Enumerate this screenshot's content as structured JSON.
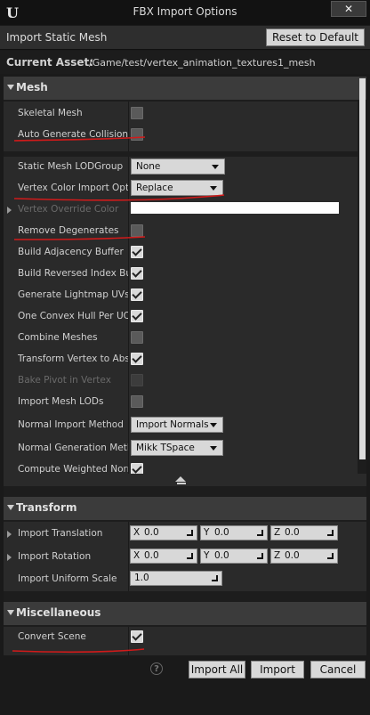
{
  "window": {
    "title": "FBX Import Options",
    "close_glyph": "✕",
    "logo_glyph": "U"
  },
  "header": {
    "title": "Import Static Mesh",
    "reset_label": "Reset to Default"
  },
  "asset": {
    "label": "Current Asset:",
    "path": "/Game/test/vertex_animation_textures1_mesh"
  },
  "sections": {
    "mesh": {
      "title": "Mesh"
    },
    "transform": {
      "title": "Transform"
    },
    "misc": {
      "title": "Miscellaneous"
    }
  },
  "mesh": {
    "skeletal_mesh": {
      "label": "Skeletal Mesh",
      "checked": false
    },
    "auto_generate_collision": {
      "label": "Auto Generate Collision",
      "checked": false
    },
    "lod_group": {
      "label": "Static Mesh LODGroup",
      "value": "None"
    },
    "vertex_color_import": {
      "label": "Vertex Color Import Option",
      "value": "Replace"
    },
    "vertex_override_color": {
      "label": "Vertex Override Color",
      "color": "#ffffff"
    },
    "remove_degenerates": {
      "label": "Remove Degenerates",
      "checked": false
    },
    "build_adjacency_buffer": {
      "label": "Build Adjacency Buffer",
      "checked": true
    },
    "build_reversed_index_buffer": {
      "label": "Build Reversed Index Buffer",
      "checked": true
    },
    "generate_lightmap_uvs": {
      "label": "Generate Lightmap UVs",
      "checked": true
    },
    "one_convex_hull": {
      "label": "One Convex Hull Per UCX",
      "checked": true
    },
    "combine_meshes": {
      "label": "Combine Meshes",
      "checked": false
    },
    "transform_vertex": {
      "label": "Transform Vertex to Absolute",
      "checked": true
    },
    "bake_pivot": {
      "label": "Bake Pivot in Vertex",
      "checked": false
    },
    "import_mesh_lods": {
      "label": "Import Mesh LODs",
      "checked": false
    },
    "normal_import_method": {
      "label": "Normal Import Method",
      "value": "Import Normals"
    },
    "normal_generation_method": {
      "label": "Normal Generation Method",
      "value": "Mikk TSpace"
    },
    "compute_weighted_normals": {
      "label": "Compute Weighted Normals",
      "checked": true
    }
  },
  "transform": {
    "import_translation": {
      "label": "Import Translation",
      "x": "0.0",
      "y": "0.0",
      "z": "0.0"
    },
    "import_rotation": {
      "label": "Import Rotation",
      "x": "0.0",
      "y": "0.0",
      "z": "0.0"
    },
    "import_uniform_scale": {
      "label": "Import Uniform Scale",
      "value": "1.0"
    },
    "axis_labels": {
      "x": "X",
      "y": "Y",
      "z": "Z"
    }
  },
  "misc": {
    "convert_scene": {
      "label": "Convert Scene",
      "checked": true
    }
  },
  "footer": {
    "help_glyph": "?",
    "import_all": "Import All",
    "import": "Import",
    "cancel": "Cancel"
  },
  "colors": {
    "annotation": "#d11a1a",
    "section_bg": "#3b3b3b",
    "row_bg": "#2a2a2a"
  }
}
